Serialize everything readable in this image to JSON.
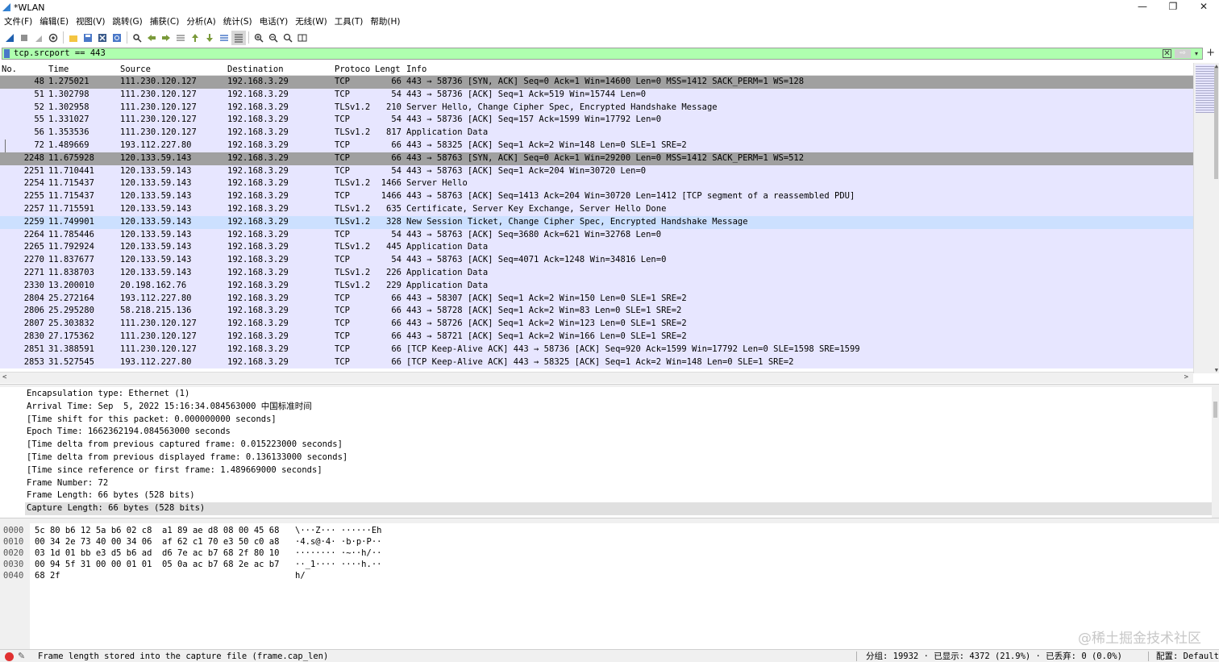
{
  "window": {
    "title": "*WLAN",
    "controls": [
      "—",
      "❐",
      "✕"
    ]
  },
  "menu": [
    "文件(F)",
    "编辑(E)",
    "视图(V)",
    "跳转(G)",
    "捕获(C)",
    "分析(A)",
    "统计(S)",
    "电话(Y)",
    "无线(W)",
    "工具(T)",
    "帮助(H)"
  ],
  "toolbar_icons": [
    "shark-fin-start-icon",
    "stop-square-icon",
    "restart-icon",
    "capture-options-icon",
    "open-folder-icon",
    "save-icon",
    "close-file-icon",
    "reload-icon",
    "find-icon",
    "back-arrow-icon",
    "forward-arrow-icon",
    "goto-packet-icon",
    "first-packet-icon",
    "last-packet-icon",
    "autoscroll-icon",
    "colorize-icon",
    "zoom-in-icon",
    "zoom-out-icon",
    "zoom-normal-icon",
    "resize-columns-icon"
  ],
  "filter": {
    "value": "tcp.srcport == 443",
    "color": "#afffaf"
  },
  "packet_list": {
    "columns": [
      "No.",
      "Time",
      "Source",
      "Destination",
      "Protoco",
      "Lengt",
      "Info"
    ],
    "rows": [
      {
        "no": "48",
        "time": "1.275021",
        "src": "111.230.120.127",
        "dst": "192.168.3.29",
        "proto": "TCP",
        "len": "66",
        "info": "443 → 58736 [SYN, ACK] Seq=0 Ack=1 Win=14600 Len=0 MSS=1412 SACK_PERM=1 WS=128"
      },
      {
        "no": "51",
        "time": "1.302798",
        "src": "111.230.120.127",
        "dst": "192.168.3.29",
        "proto": "TCP",
        "len": "54",
        "info": "443 → 58736 [ACK] Seq=1 Ack=519 Win=15744 Len=0"
      },
      {
        "no": "52",
        "time": "1.302958",
        "src": "111.230.120.127",
        "dst": "192.168.3.29",
        "proto": "TLSv1.2",
        "len": "210",
        "info": "Server Hello, Change Cipher Spec, Encrypted Handshake Message"
      },
      {
        "no": "55",
        "time": "1.331027",
        "src": "111.230.120.127",
        "dst": "192.168.3.29",
        "proto": "TCP",
        "len": "54",
        "info": "443 → 58736 [ACK] Seq=157 Ack=1599 Win=17792 Len=0"
      },
      {
        "no": "56",
        "time": "1.353536",
        "src": "111.230.120.127",
        "dst": "192.168.3.29",
        "proto": "TLSv1.2",
        "len": "817",
        "info": "Application Data"
      },
      {
        "no": "72",
        "time": "1.489669",
        "src": "193.112.227.80",
        "dst": "192.168.3.29",
        "proto": "TCP",
        "len": "66",
        "info": "443 → 58325 [ACK] Seq=1 Ack=2 Win=148 Len=0 SLE=1 SRE=2"
      },
      {
        "no": "2248",
        "time": "11.675928",
        "src": "120.133.59.143",
        "dst": "192.168.3.29",
        "proto": "TCP",
        "len": "66",
        "info": "443 → 58763 [SYN, ACK] Seq=0 Ack=1 Win=29200 Len=0 MSS=1412 SACK_PERM=1 WS=512"
      },
      {
        "no": "2251",
        "time": "11.710441",
        "src": "120.133.59.143",
        "dst": "192.168.3.29",
        "proto": "TCP",
        "len": "54",
        "info": "443 → 58763 [ACK] Seq=1 Ack=204 Win=30720 Len=0"
      },
      {
        "no": "2254",
        "time": "11.715437",
        "src": "120.133.59.143",
        "dst": "192.168.3.29",
        "proto": "TLSv1.2",
        "len": "1466",
        "info": "Server Hello"
      },
      {
        "no": "2255",
        "time": "11.715437",
        "src": "120.133.59.143",
        "dst": "192.168.3.29",
        "proto": "TCP",
        "len": "1466",
        "info": "443 → 58763 [ACK] Seq=1413 Ack=204 Win=30720 Len=1412 [TCP segment of a reassembled PDU]"
      },
      {
        "no": "2257",
        "time": "11.715591",
        "src": "120.133.59.143",
        "dst": "192.168.3.29",
        "proto": "TLSv1.2",
        "len": "635",
        "info": "Certificate, Server Key Exchange, Server Hello Done"
      },
      {
        "no": "2259",
        "time": "11.749901",
        "src": "120.133.59.143",
        "dst": "192.168.3.29",
        "proto": "TLSv1.2",
        "len": "328",
        "info": "New Session Ticket, Change Cipher Spec, Encrypted Handshake Message"
      },
      {
        "no": "2264",
        "time": "11.785446",
        "src": "120.133.59.143",
        "dst": "192.168.3.29",
        "proto": "TCP",
        "len": "54",
        "info": "443 → 58763 [ACK] Seq=3680 Ack=621 Win=32768 Len=0"
      },
      {
        "no": "2265",
        "time": "11.792924",
        "src": "120.133.59.143",
        "dst": "192.168.3.29",
        "proto": "TLSv1.2",
        "len": "445",
        "info": "Application Data"
      },
      {
        "no": "2270",
        "time": "11.837677",
        "src": "120.133.59.143",
        "dst": "192.168.3.29",
        "proto": "TCP",
        "len": "54",
        "info": "443 → 58763 [ACK] Seq=4071 Ack=1248 Win=34816 Len=0"
      },
      {
        "no": "2271",
        "time": "11.838703",
        "src": "120.133.59.143",
        "dst": "192.168.3.29",
        "proto": "TLSv1.2",
        "len": "226",
        "info": "Application Data"
      },
      {
        "no": "2330",
        "time": "13.200010",
        "src": "20.198.162.76",
        "dst": "192.168.3.29",
        "proto": "TLSv1.2",
        "len": "229",
        "info": "Application Data"
      },
      {
        "no": "2804",
        "time": "25.272164",
        "src": "193.112.227.80",
        "dst": "192.168.3.29",
        "proto": "TCP",
        "len": "66",
        "info": "443 → 58307 [ACK] Seq=1 Ack=2 Win=150 Len=0 SLE=1 SRE=2"
      },
      {
        "no": "2806",
        "time": "25.295280",
        "src": "58.218.215.136",
        "dst": "192.168.3.29",
        "proto": "TCP",
        "len": "66",
        "info": "443 → 58728 [ACK] Seq=1 Ack=2 Win=83 Len=0 SLE=1 SRE=2"
      },
      {
        "no": "2807",
        "time": "25.303832",
        "src": "111.230.120.127",
        "dst": "192.168.3.29",
        "proto": "TCP",
        "len": "66",
        "info": "443 → 58726 [ACK] Seq=1 Ack=2 Win=123 Len=0 SLE=1 SRE=2"
      },
      {
        "no": "2830",
        "time": "27.175362",
        "src": "111.230.120.127",
        "dst": "192.168.3.29",
        "proto": "TCP",
        "len": "66",
        "info": "443 → 58721 [ACK] Seq=1 Ack=2 Win=166 Len=0 SLE=1 SRE=2"
      },
      {
        "no": "2851",
        "time": "31.388591",
        "src": "111.230.120.127",
        "dst": "192.168.3.29",
        "proto": "TCP",
        "len": "66",
        "info": "[TCP Keep-Alive ACK] 443 → 58736 [ACK] Seq=920 Ack=1599 Win=17792 Len=0 SLE=1598 SRE=1599"
      },
      {
        "no": "2853",
        "time": "31.527545",
        "src": "193.112.227.80",
        "dst": "192.168.3.29",
        "proto": "TCP",
        "len": "66",
        "info": "[TCP Keep-Alive ACK] 443 → 58325 [ACK] Seq=1 Ack=2 Win=148 Len=0 SLE=1 SRE=2"
      }
    ]
  },
  "details": [
    "Encapsulation type: Ethernet (1)",
    "Arrival Time: Sep  5, 2022 15:16:34.084563000 中国标准时间",
    "[Time shift for this packet: 0.000000000 seconds]",
    "Epoch Time: 1662362194.084563000 seconds",
    "[Time delta from previous captured frame: 0.015223000 seconds]",
    "[Time delta from previous displayed frame: 0.136133000 seconds]",
    "[Time since reference or first frame: 1.489669000 seconds]",
    "Frame Number: 72",
    "Frame Length: 66 bytes (528 bits)",
    "Capture Length: 66 bytes (528 bits)"
  ],
  "bytes": [
    {
      "off": "0000",
      "hex": "5c 80 b6 12 5a b6 02 c8  a1 89 ae d8 08 00 45 68",
      "ascii": "\\···Z··· ······Eh"
    },
    {
      "off": "0010",
      "hex": "00 34 2e 73 40 00 34 06  af 62 c1 70 e3 50 c0 a8",
      "ascii": "·4.s@·4· ·b·p·P··"
    },
    {
      "off": "0020",
      "hex": "03 1d 01 bb e3 d5 b6 ad  d6 7e ac b7 68 2f 80 10",
      "ascii": "········ ·~··h/··"
    },
    {
      "off": "0030",
      "hex": "00 94 5f 31 00 00 01 01  05 0a ac b7 68 2e ac b7",
      "ascii": "··_1···· ····h.··"
    },
    {
      "off": "0040",
      "hex": "68 2f",
      "ascii": "h/"
    }
  ],
  "status": {
    "message": "Frame length stored into the capture file (frame.cap_len)",
    "stats": "分组: 19932 · 已显示: 4372 (21.9%) · 已丢弃: 0 (0.0%)",
    "profile": "配置: Default"
  },
  "watermark": "@稀土掘金技术社区",
  "colors": {
    "row_tcp": "#e7e6ff",
    "row_selected": "#a0a0a0",
    "row_highlight": "#cce0ff",
    "filter_ok": "#afffaf"
  }
}
